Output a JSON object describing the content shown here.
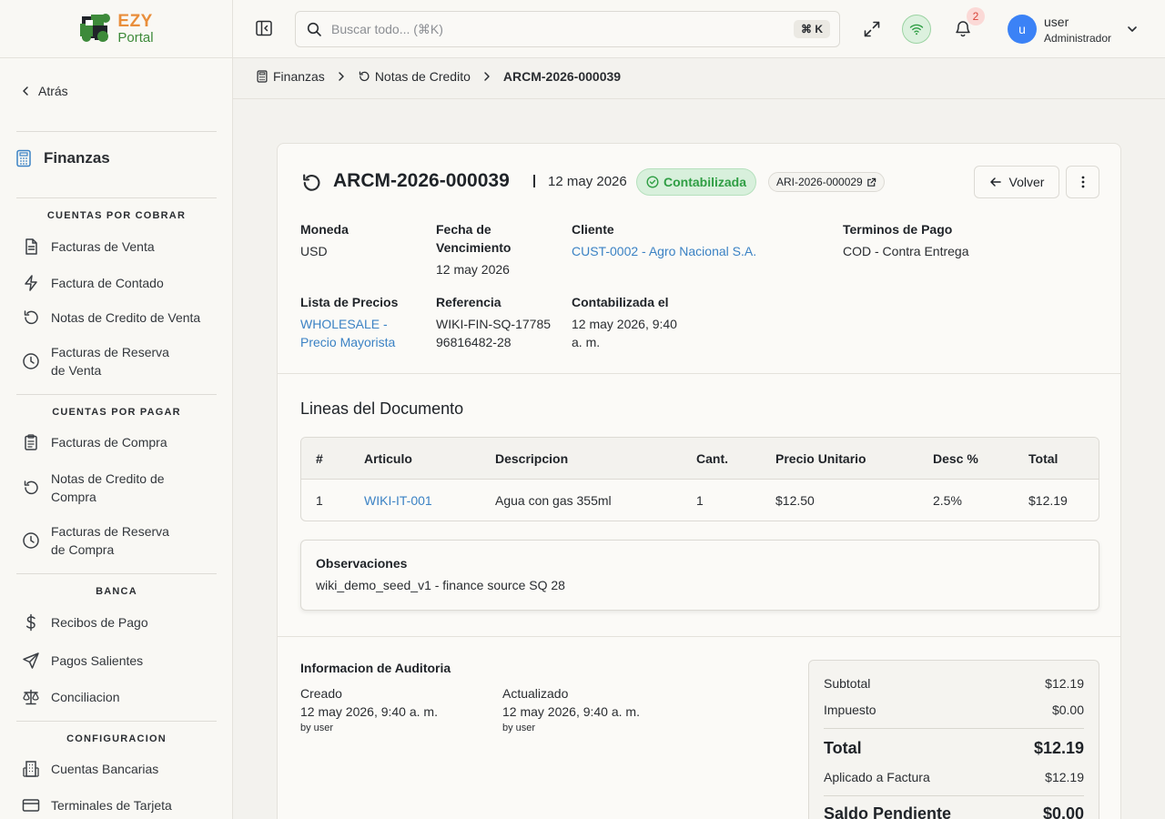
{
  "app": {
    "logo_line1": "EZY",
    "logo_line2": "Portal"
  },
  "header": {
    "search_placeholder": "Buscar todo... (⌘K)",
    "search_shortcut": "⌘ K",
    "notifications_count": "2",
    "user_initial": "u",
    "user_name": "user",
    "user_role": "Administrador"
  },
  "sidebar": {
    "back_label": "Atrás",
    "module_title": "Finanzas",
    "sections": [
      {
        "title": "CUENTAS POR COBRAR"
      },
      {
        "title": "CUENTAS POR PAGAR"
      },
      {
        "title": "BANCA"
      },
      {
        "title": "CONFIGURACION"
      }
    ],
    "items": [
      {
        "label": "Facturas de Venta",
        "icon": "file-text-icon"
      },
      {
        "label": "Factura de Contado",
        "icon": "lightning-icon"
      },
      {
        "label": "Notas de Credito de Venta",
        "icon": "rotate-ccw-icon"
      },
      {
        "label": "Facturas de Reserva de Venta",
        "icon": "clock-icon"
      },
      {
        "label": "Facturas de Compra",
        "icon": "clipboard-icon"
      },
      {
        "label": "Notas de Credito de Compra",
        "icon": "rotate-ccw-icon"
      },
      {
        "label": "Facturas de Reserva de Compra",
        "icon": "clock-icon"
      },
      {
        "label": "Recibos de Pago",
        "icon": "dollar-icon"
      },
      {
        "label": "Pagos Salientes",
        "icon": "send-icon"
      },
      {
        "label": "Conciliacion",
        "icon": "scale-icon"
      },
      {
        "label": "Cuentas Bancarias",
        "icon": "bank-icon"
      },
      {
        "label": "Terminales de Tarjeta",
        "icon": "credit-card-icon"
      }
    ]
  },
  "breadcrumb": {
    "items": [
      "Finanzas",
      "Notas de Credito",
      "ARCM-2026-000039"
    ]
  },
  "document": {
    "id": "ARCM-2026-000039",
    "date": "12 may 2026",
    "status": "Contabilizada",
    "status_color": "#2f9e44",
    "ref_chip": "ARI-2026-000029",
    "back_button": "Volver",
    "fields": {
      "moneda_label": "Moneda",
      "moneda_value": "USD",
      "vencimiento_label": "Fecha de Vencimiento",
      "vencimiento_value": "12 may 2026",
      "cliente_label": "Cliente",
      "cliente_value": "CUST-0002 - Agro Nacional S.A.",
      "terminos_label": "Terminos de Pago",
      "terminos_value": "COD - Contra Entrega",
      "lista_label": "Lista de Precios",
      "lista_value": "WHOLESALE - Precio Mayorista",
      "referencia_label": "Referencia",
      "referencia_value": "WIKI-FIN-SQ-1778596816482-28",
      "contabilizada_label": "Contabilizada el",
      "contabilizada_value": "12 may 2026, 9:40 a. m."
    },
    "lines_title": "Lineas del Documento",
    "table": {
      "headers": [
        "#",
        "Articulo",
        "Descripcion",
        "Cant.",
        "Precio Unitario",
        "Desc %",
        "Total"
      ],
      "rows": [
        [
          "1",
          "WIKI-IT-001",
          "Agua con gas 355ml",
          "1",
          "$12.50",
          "2.5%",
          "$12.19"
        ]
      ]
    },
    "observaciones_title": "Observaciones",
    "observaciones_text": "wiki_demo_seed_v1 - finance source SQ 28",
    "audit": {
      "title": "Informacion de Auditoria",
      "created_label": "Creado",
      "created_value": "12 may 2026, 9:40 a. m.",
      "created_by": "by user",
      "updated_label": "Actualizado",
      "updated_value": "12 may 2026, 9:40 a. m.",
      "updated_by": "by user"
    },
    "totals": {
      "subtotal_label": "Subtotal",
      "subtotal_value": "$12.19",
      "impuesto_label": "Impuesto",
      "impuesto_value": "$0.00",
      "total_label": "Total",
      "total_value": "$12.19",
      "aplicado_label": "Aplicado a Factura",
      "aplicado_value": "$12.19",
      "saldo_label": "Saldo Pendiente",
      "saldo_value": "$0.00"
    }
  },
  "colors": {
    "accent": "#3b82c4",
    "avatar": "#3b82f6",
    "logo_orange": "#e98e3b",
    "logo_green": "#3d8a3a"
  }
}
